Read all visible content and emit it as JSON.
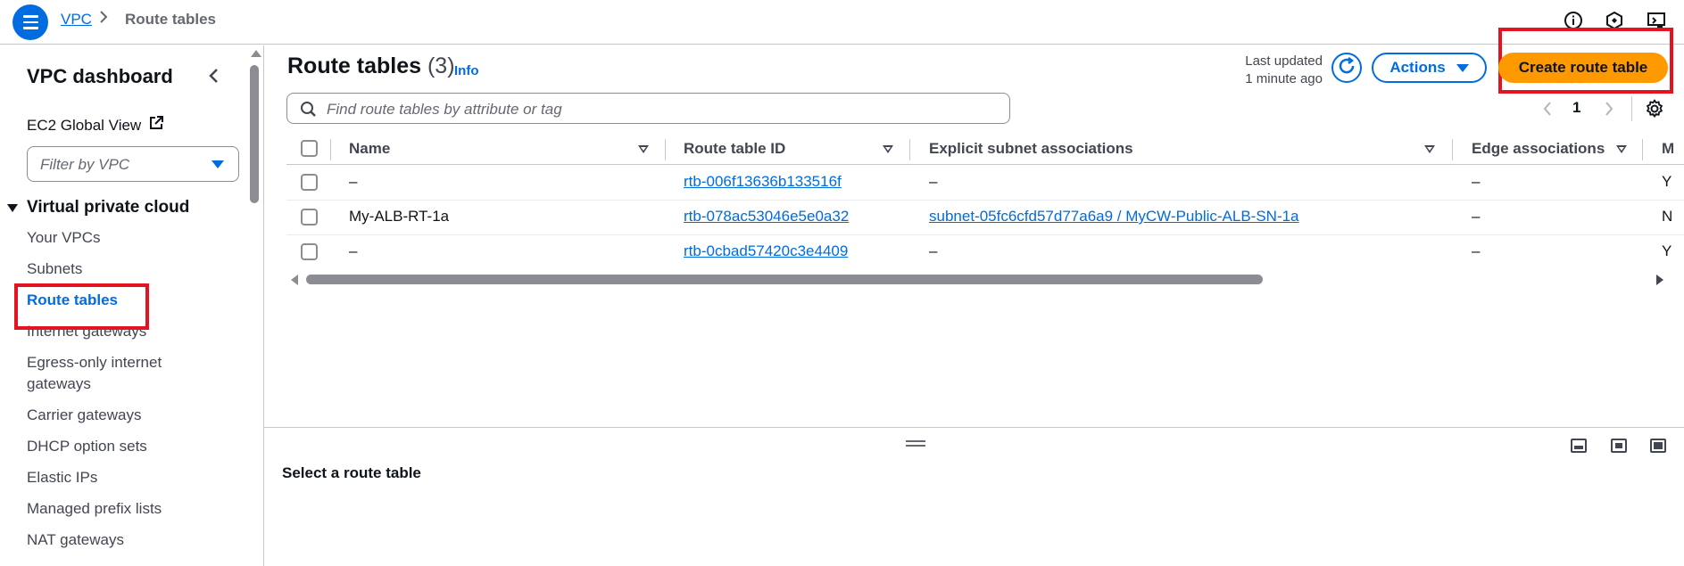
{
  "breadcrumb": {
    "root": "VPC",
    "separator": ">",
    "current": "Route tables"
  },
  "sidebar": {
    "title": "VPC dashboard",
    "ec2_global_view": "EC2 Global View",
    "filter_placeholder": "Filter by VPC",
    "section": "Virtual private cloud",
    "items": [
      {
        "label": "Your VPCs"
      },
      {
        "label": "Subnets"
      },
      {
        "label": "Route tables",
        "active": true
      },
      {
        "label": "Internet gateways"
      },
      {
        "label": "Egress-only internet gateways",
        "line1": "Egress-only internet",
        "line2": "gateways"
      },
      {
        "label": "Carrier gateways"
      },
      {
        "label": "DHCP option sets"
      },
      {
        "label": "Elastic IPs"
      },
      {
        "label": "Managed prefix lists"
      },
      {
        "label": "NAT gateways"
      }
    ]
  },
  "main": {
    "title": "Route tables",
    "count": "(3)",
    "info": "Info",
    "last_updated_line1": "Last updated",
    "last_updated_line2": "1 minute ago",
    "actions_label": "Actions",
    "create_label": "Create route table",
    "search_placeholder": "Find route tables by attribute or tag",
    "page_number": "1"
  },
  "table": {
    "columns": [
      "Name",
      "Route table ID",
      "Explicit subnet associations",
      "Edge associations",
      "M"
    ],
    "rows": [
      {
        "name": "–",
        "id": "rtb-006f13636b133516f",
        "subnet": "–",
        "edge": "–",
        "main": "Y"
      },
      {
        "name": "My-ALB-RT-1a",
        "id": "rtb-078ac53046e5e0a32",
        "subnet": "subnet-05fc6cfd57d77a6a9 / MyCW-Public-ALB-SN-1a",
        "edge": "–",
        "main": "N"
      },
      {
        "name": "–",
        "id": "rtb-0cbad57420c3e4409",
        "subnet": "–",
        "edge": "–",
        "main": "Y"
      }
    ]
  },
  "split_panel": {
    "title": "Select a route table"
  },
  "colors": {
    "accent": "#006ce0",
    "primary_button": "#ff9900",
    "highlight_box": "#e3141f"
  }
}
